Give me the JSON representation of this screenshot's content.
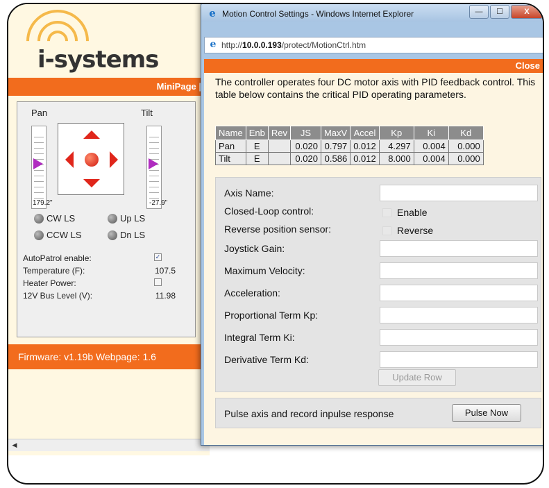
{
  "mini_page": {
    "logo_text": "i-systems",
    "minipage_label": "MiniPage |",
    "pan_label": "Pan",
    "tilt_label": "Tilt",
    "pan_value": "179.2\"",
    "tilt_value": "-27.9\"",
    "limit_switches": [
      "CW LS",
      "Up LS",
      "CCW LS",
      "Dn LS"
    ],
    "status": [
      {
        "label": "AutoPatrol enable:",
        "value": "",
        "checked": true
      },
      {
        "label": "Temperature (F):",
        "value": "107.5"
      },
      {
        "label": "Heater Power:",
        "value": "",
        "checked": false
      },
      {
        "label": "12V Bus Level (V):",
        "value": "11.98"
      }
    ],
    "firmware_text": "Firmware: v1.19b  Webpage: 1.6"
  },
  "window": {
    "title": "Motion Control Settings - Windows Internet Explorer",
    "url_prefix": "http://",
    "url_host": "10.0.0.193",
    "url_path": "/protect/MotionCtrl.htm",
    "minimize_label": "—",
    "maximize_label": "☐",
    "close_label": "X"
  },
  "page": {
    "close_label": "Close",
    "description": "The controller operates four DC motor axis with PID feedback control. This table below contains the critical PID operating parameters.",
    "table": {
      "headers": [
        "Name",
        "Enb",
        "Rev",
        "JS",
        "MaxV",
        "Accel",
        "Kp",
        "Ki",
        "Kd"
      ],
      "rows": [
        [
          "Pan",
          "E",
          "",
          "0.020",
          "0.797",
          "0.012",
          "4.297",
          "0.004",
          "0.000"
        ],
        [
          "Tilt",
          "E",
          "",
          "0.020",
          "0.586",
          "0.012",
          "8.000",
          "0.004",
          "0.000"
        ]
      ]
    },
    "form": {
      "axis_name": "Axis Name:",
      "closed_loop": "Closed-Loop control:",
      "enable": "Enable",
      "reverse_sensor": "Reverse position sensor:",
      "reverse": "Reverse",
      "joystick_gain": "Joystick Gain:",
      "max_velocity": "Maximum Velocity:",
      "acceleration": "Acceleration:",
      "kp": "Proportional Term Kp:",
      "ki": "Integral Term Ki:",
      "kd": "Derivative Term Kd:",
      "update_row": "Update Row"
    },
    "pulse": {
      "label": "Pulse axis and record inpulse response",
      "button": "Pulse Now"
    }
  },
  "colors": {
    "accent_orange": "#f26c1d",
    "joystick_red": "#e0261b",
    "slider_marker": "#b02cc0",
    "logo_arc": "#f5b94a"
  }
}
